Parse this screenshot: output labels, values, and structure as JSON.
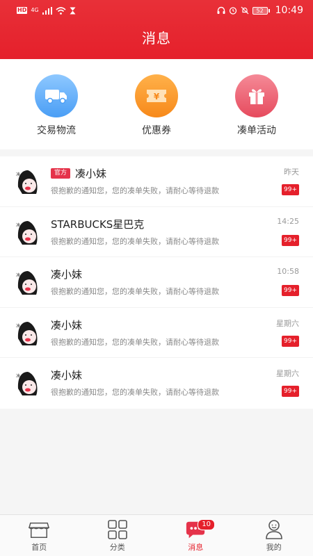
{
  "status_bar": {
    "hd": "HD",
    "network": "4G",
    "battery": "52",
    "time": "10:49"
  },
  "header": {
    "title": "消息"
  },
  "quick_entries": [
    {
      "label": "交易物流",
      "icon": "truck-icon"
    },
    {
      "label": "优惠券",
      "icon": "coupon-icon"
    },
    {
      "label": "凑单活动",
      "icon": "gift-icon"
    }
  ],
  "messages": [
    {
      "tag": "官方",
      "name": "凑小妹",
      "preview": "很抱歉的通知您，您的凑单失败，请耐心等待退款",
      "time": "昨天",
      "count": "99+"
    },
    {
      "tag": "",
      "name": "STARBUCKS星巴克",
      "preview": "很抱歉的通知您，您的凑单失败，请耐心等待退款",
      "time": "14:25",
      "count": "99+"
    },
    {
      "tag": "",
      "name": "凑小妹",
      "preview": "很抱歉的通知您，您的凑单失败，请耐心等待退款",
      "time": "10:58",
      "count": "99+"
    },
    {
      "tag": "",
      "name": "凑小妹",
      "preview": "很抱歉的通知您，您的凑单失败，请耐心等待退款",
      "time": "星期六",
      "count": "99+"
    },
    {
      "tag": "",
      "name": "凑小妹",
      "preview": "很抱歉的通知您，您的凑单失败，请耐心等待退款",
      "time": "星期六",
      "count": "99+"
    }
  ],
  "tabbar": [
    {
      "label": "首页",
      "icon": "shop-icon"
    },
    {
      "label": "分类",
      "icon": "grid-icon"
    },
    {
      "label": "消息",
      "icon": "chat-icon",
      "badge": "10",
      "active": true
    },
    {
      "label": "我的",
      "icon": "user-icon"
    }
  ],
  "colors": {
    "accent": "#e5202b",
    "tag": "#e5334a"
  }
}
